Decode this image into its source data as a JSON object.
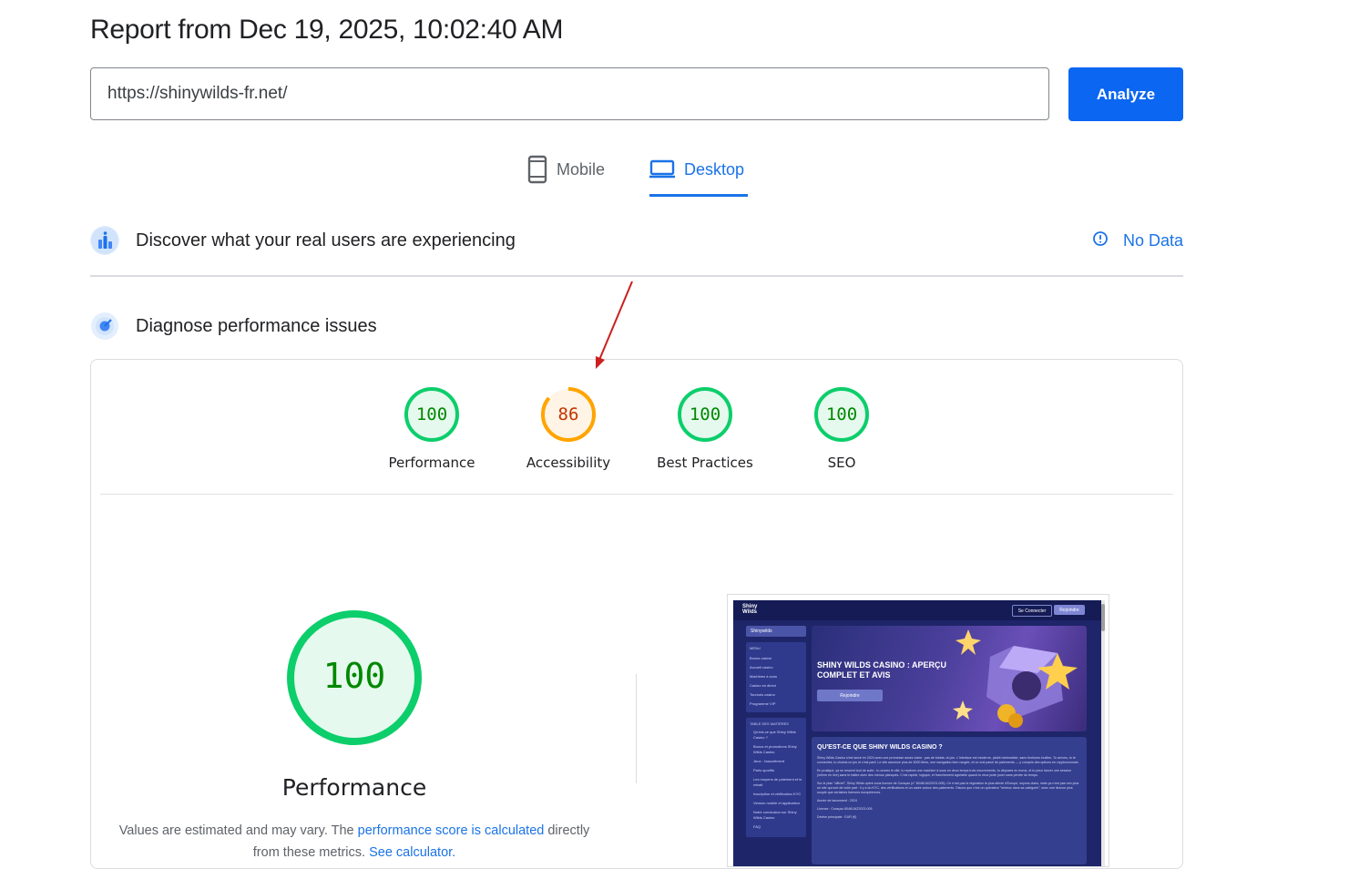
{
  "report": {
    "title": "Report from Dec 19, 2025, 10:02:40 AM"
  },
  "search": {
    "url_value": "https://shinywilds-fr.net/",
    "analyze_label": "Analyze"
  },
  "device_tabs": {
    "mobile_label": "Mobile",
    "desktop_label": "Desktop",
    "selected": "Desktop"
  },
  "field_data": {
    "title": "Discover what your real users are experiencing",
    "status_label": "No Data"
  },
  "lab_data": {
    "title": "Diagnose performance issues"
  },
  "scores": [
    {
      "label": "Performance",
      "value": "100",
      "fraction": 1.0,
      "color": "#0cce6b",
      "text_color": "#008800",
      "fill": "#e6f9ee"
    },
    {
      "label": "Accessibility",
      "value": "86",
      "fraction": 0.86,
      "color": "#ffa400",
      "text_color": "#c33300",
      "fill": "#fff4e5"
    },
    {
      "label": "Best Practices",
      "value": "100",
      "fraction": 1.0,
      "color": "#0cce6b",
      "text_color": "#008800",
      "fill": "#e6f9ee"
    },
    {
      "label": "SEO",
      "value": "100",
      "fraction": 1.0,
      "color": "#0cce6b",
      "text_color": "#008800",
      "fill": "#e6f9ee"
    }
  ],
  "performance_detail": {
    "score": "100",
    "title": "Performance",
    "note_prefix": "Values are estimated and may vary. The ",
    "note_link": "performance score is calculated",
    "note_middle": " directly from these metrics. ",
    "note_link2": "See calculator."
  },
  "thumbnail": {
    "logo": "Shiny Wilds",
    "login_btn": "Se Connecter",
    "signup_btn": "Rejoindre",
    "side_top": "Shinywilds",
    "menu_head": "MENU",
    "menu_items": [
      "Bonus casino",
      "Accueil casino",
      "Machines à sous",
      "Casino en direct",
      "Tournois casino",
      "Programme VIP"
    ],
    "toc_head": "TABLE DES MATIÈRES",
    "toc_items": [
      "Qu'est-ce que Shiny Wilds Casino ?",
      "Bonus et promotions Shiny Wilds Casino",
      "Jeux : l'assortiment",
      "Paris sportifs",
      "Les moyens de paiement et le retrait",
      "Inscription et vérification KYC",
      "Version mobile et application",
      "Notre conclusion sur Shiny Wilds Casino",
      "FAQ"
    ],
    "hero_title": "SHINY WILDS CASINO : APERÇU COMPLET ET AVIS",
    "hero_btn": "Rejoindre",
    "article_title": "QU'EST-CE QUE SHINY WILDS CASINO ?",
    "article_p1": "Shiny Wilds Casino s'est lancé en 2024 avec une promesse assez claire : pas de blabla, du jeu. L'interface est moderne, plutôt minimaliste, sans fioritures inutiles. Tu arrives, tu te connectes, tu choisis un jeu et c'est parti. Le site annonce plus de 3000 titres, une navigation bien rangée, et un vrai panel de paiements — y compris des options en cryptomonnaie.",
    "article_p2": "En pratique, ça se ressent tout de suite : tu ouvres le site, tu repères une machine à sous en deux temps trois mouvements, tu déposes en euros, et tu peux lancer une session (même en live) sans te battre avec des menus planqués. C'est rapide, logique, et franchement agréable quand tu veux juste jouer sans perdre du temps.",
    "article_p3": "Sur le plan \"officiel\", Shiny Wilds opère sous licence de Curaçao (n° 8048/JAZ2023-005). Ce n'est pas la régulation la plus stricte d'Europe, soyons clairs, mais ça n'est pas non plus un site qui sort de nulle part : il y a du KYC, des vérifications et un cadre autour des paiements. Disons que c'est un opérateur \"sérieux dans sa catégorie\", avec une licence plus souple que certaines licences européennes.",
    "facts": [
      "Année de lancement : 2024",
      "Licence : Curaçao 8048/JAZ2023-005",
      "Devise principale : EUR (€)"
    ]
  },
  "colors": {
    "accent": "#1a73e8",
    "button": "#0b66f2",
    "pass": "#0cce6b",
    "average": "#ffa400"
  }
}
